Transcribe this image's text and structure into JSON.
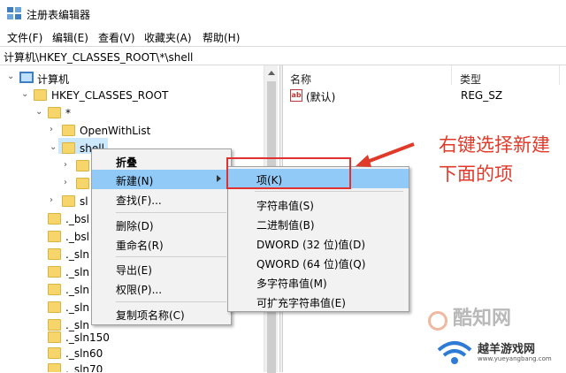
{
  "window": {
    "title": "注册表编辑器"
  },
  "menu": [
    "文件(F)",
    "编辑(E)",
    "查看(V)",
    "收藏夹(A)",
    "帮助(H)"
  ],
  "address": "计算机\\HKEY_CLASSES_ROOT\\*\\shell",
  "tree": {
    "computer": "计算机",
    "root": "HKEY_CLASSES_ROOT",
    "star": "*",
    "openwithlist": "OpenWithList",
    "shell": "shell",
    "sl": "sl",
    "items": [
      "._bsl",
      "._bsl",
      "._sln",
      "._sln",
      "._sln",
      "._sln",
      "._sln",
      "._sln150",
      "._sln60",
      "._sln70"
    ]
  },
  "list": {
    "col_name": "名称",
    "col_type": "类型",
    "row": {
      "name": "(默认)",
      "type": "REG_SZ",
      "icon": "ab"
    }
  },
  "context_menu": [
    "折叠",
    "新建(N)",
    "查找(F)...",
    "删除(D)",
    "重命名(R)",
    "导出(E)",
    "权限(P)...",
    "复制项名称(C)"
  ],
  "submenu": [
    "项(K)",
    "字符串值(S)",
    "二进制值(B)",
    "DWORD (32 位)值(D)",
    "QWORD (64 位)值(Q)",
    "多字符串值(M)",
    "可扩充字符串值(E)"
  ],
  "annotation": "右键选择新建下面的项",
  "watermarks": {
    "w1": "酷知网",
    "w2": "越羊游戏网",
    "w2_url": "www.yueyangbang.com"
  },
  "colors": {
    "highlight": "#91c9f7",
    "selection": "#cce8ff",
    "red": "#e03030"
  }
}
